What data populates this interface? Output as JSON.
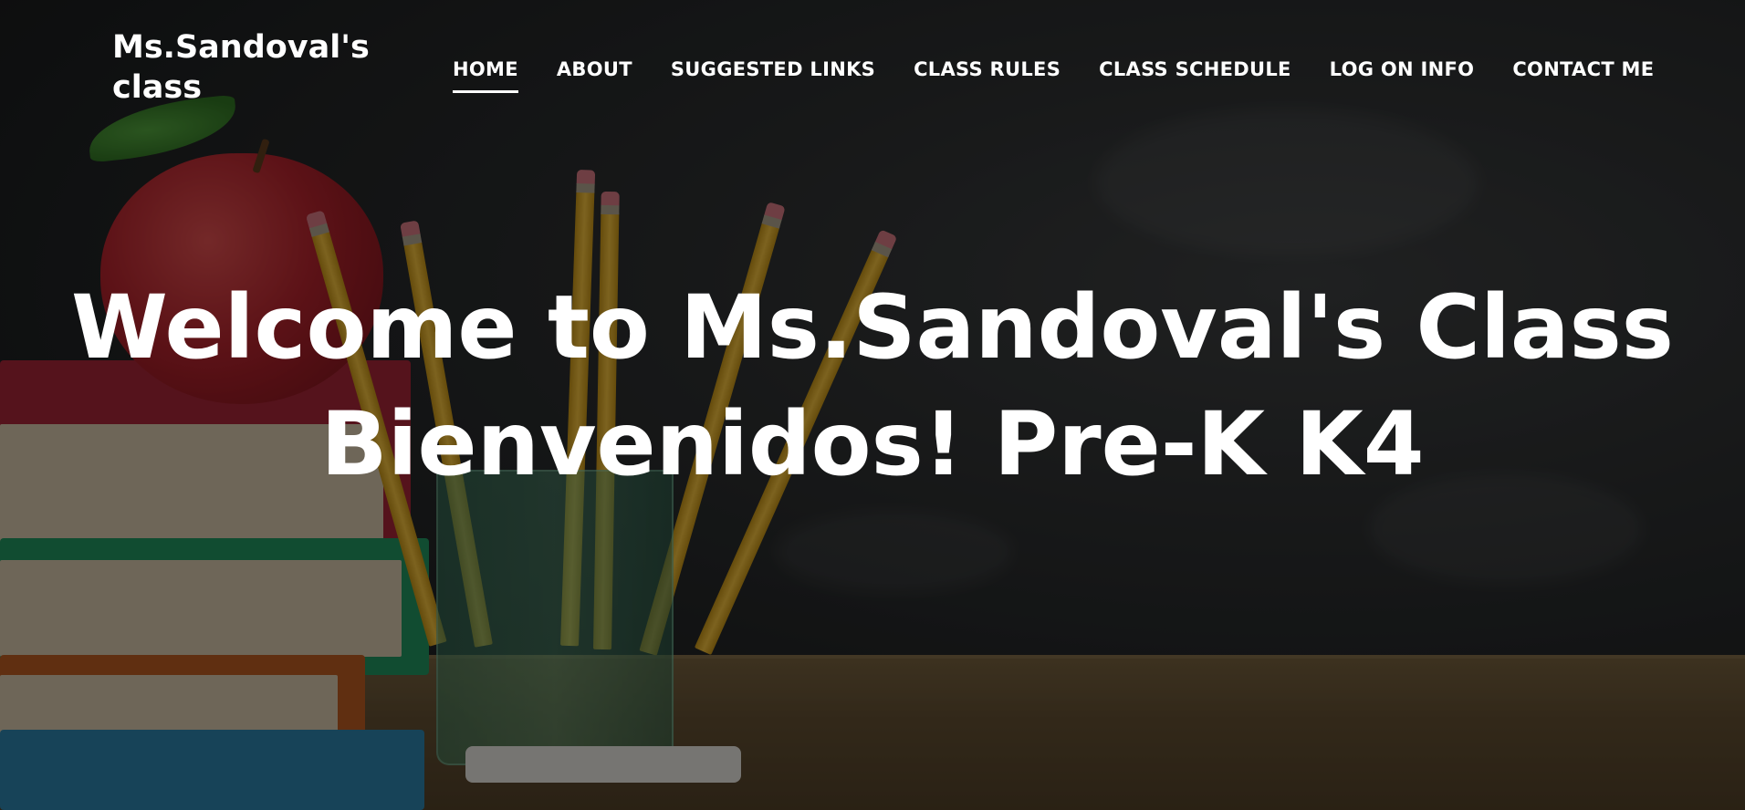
{
  "header": {
    "site_title": "Ms.Sandoval's class"
  },
  "nav": {
    "items": [
      {
        "label": "HOME",
        "active": true
      },
      {
        "label": "ABOUT",
        "active": false
      },
      {
        "label": "SUGGESTED LINKS",
        "active": false
      },
      {
        "label": "CLASS RULES",
        "active": false
      },
      {
        "label": "CLASS SCHEDULE",
        "active": false
      },
      {
        "label": "LOG ON INFO",
        "active": false
      },
      {
        "label": "CONTACT ME",
        "active": false
      }
    ]
  },
  "hero": {
    "headline_line1": "Welcome to Ms.Sandoval's Class",
    "headline_line2": "Bienvenidos! Pre-K K4",
    "background_image": "chalkboard-apple-books-pencils-image"
  },
  "colors": {
    "text": "#ffffff",
    "chalkboard": "#2a2c2d",
    "desk": "#5c4a2f",
    "apple": "#a8212a"
  }
}
